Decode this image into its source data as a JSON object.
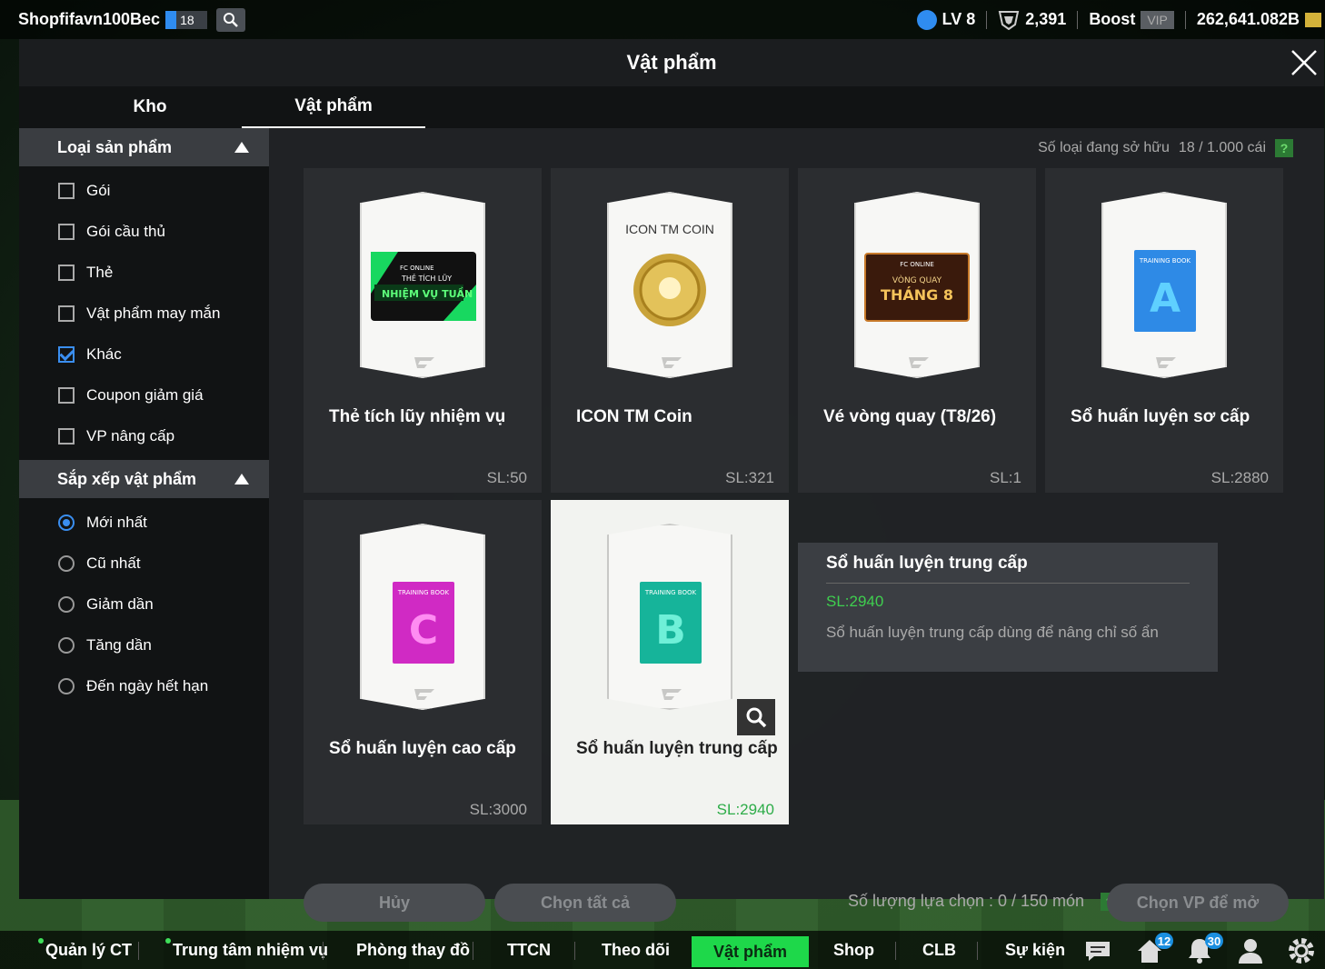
{
  "topbar": {
    "username": "Shopfifavn100Bec",
    "level_badge": "18",
    "lv": "LV 8",
    "trophies": "2,391",
    "boost": "Boost",
    "vip": "VIP",
    "coins": "262,641.082B"
  },
  "panel": {
    "title": "Vật phẩm",
    "tabs": [
      {
        "label": "Kho",
        "active": false
      },
      {
        "label": "Vật phẩm",
        "active": true
      }
    ]
  },
  "sidebar": {
    "category_title": "Loại sản phẩm",
    "categories": [
      {
        "label": "Gói",
        "checked": false
      },
      {
        "label": "Gói cầu thủ",
        "checked": false
      },
      {
        "label": "Thẻ",
        "checked": false
      },
      {
        "label": "Vật phẩm may mắn",
        "checked": false
      },
      {
        "label": "Khác",
        "checked": true
      },
      {
        "label": "Coupon giảm giá",
        "checked": false
      },
      {
        "label": "VP nâng cấp",
        "checked": false
      }
    ],
    "sort_title": "Sắp xếp vật phẩm",
    "sorts": [
      {
        "label": "Mới nhất",
        "selected": true
      },
      {
        "label": "Cũ nhất",
        "selected": false
      },
      {
        "label": "Giảm dần",
        "selected": false
      },
      {
        "label": "Tăng dần",
        "selected": false
      },
      {
        "label": "Đến ngày hết hạn",
        "selected": false
      }
    ]
  },
  "content": {
    "owned_label": "Số loại đang sở hữu",
    "owned_value": "18 / 1.000 cái",
    "help": "?",
    "items": [
      {
        "name": "Thẻ tích lũy nhiệm vụ",
        "qty": "SL:50",
        "art": "mission",
        "art_text": [
          "FC ONLINE",
          "THẺ TÍCH LŨY",
          "NHIỆM VỤ TUẦN"
        ]
      },
      {
        "name": "ICON TM Coin",
        "qty": "SL:321",
        "art": "coin",
        "art_text": [
          "ICON TM COIN"
        ]
      },
      {
        "name": "Vé vòng quay (T8/26)",
        "qty": "SL:1",
        "art": "ticket",
        "art_text": [
          "FC ONLINE",
          "VÒNG QUAY",
          "THÁNG 8"
        ]
      },
      {
        "name": "Sổ huấn luyện sơ cấp",
        "qty": "SL:2880",
        "art": "book",
        "art_text": [
          "TRAINING BOOK",
          "A"
        ],
        "book_color": "#2e8ae6"
      },
      {
        "name": "Sổ huấn luyện cao cấp",
        "qty": "SL:3000",
        "art": "book",
        "art_text": [
          "TRAINING BOOK",
          "C"
        ],
        "book_color": "#d02ac4"
      },
      {
        "name": "Sổ huấn luyện trung cấp",
        "qty": "SL:2940",
        "art": "book",
        "art_text": [
          "TRAINING BOOK",
          "B"
        ],
        "book_color": "#16b49a",
        "selected": true
      }
    ],
    "tooltip": {
      "name": "Sổ huấn luyện trung cấp",
      "qty": "SL:2940",
      "desc": "Sổ huấn luyện trung cấp dùng để nâng chỉ số ẩn"
    },
    "actions": {
      "cancel": "Hủy",
      "select_all": "Chọn tất cả",
      "selection_label": "Số lượng lựa chọn : 0 / 150 món",
      "open": "Chọn VP để mở"
    }
  },
  "nav": {
    "items": [
      "Quản lý CT",
      "Trung tâm nhiệm vụ",
      "Phòng thay đồ",
      "TTCN",
      "Theo dõi",
      "Vật phẩm",
      "Shop",
      "CLB",
      "Sự kiện"
    ],
    "active": "Vật phẩm",
    "badges": {
      "home": "12",
      "bell": "30"
    }
  },
  "colors": {
    "accent_green": "#1ed84a",
    "check_blue": "#3a8ef0",
    "qty_green": "#2dac48"
  }
}
